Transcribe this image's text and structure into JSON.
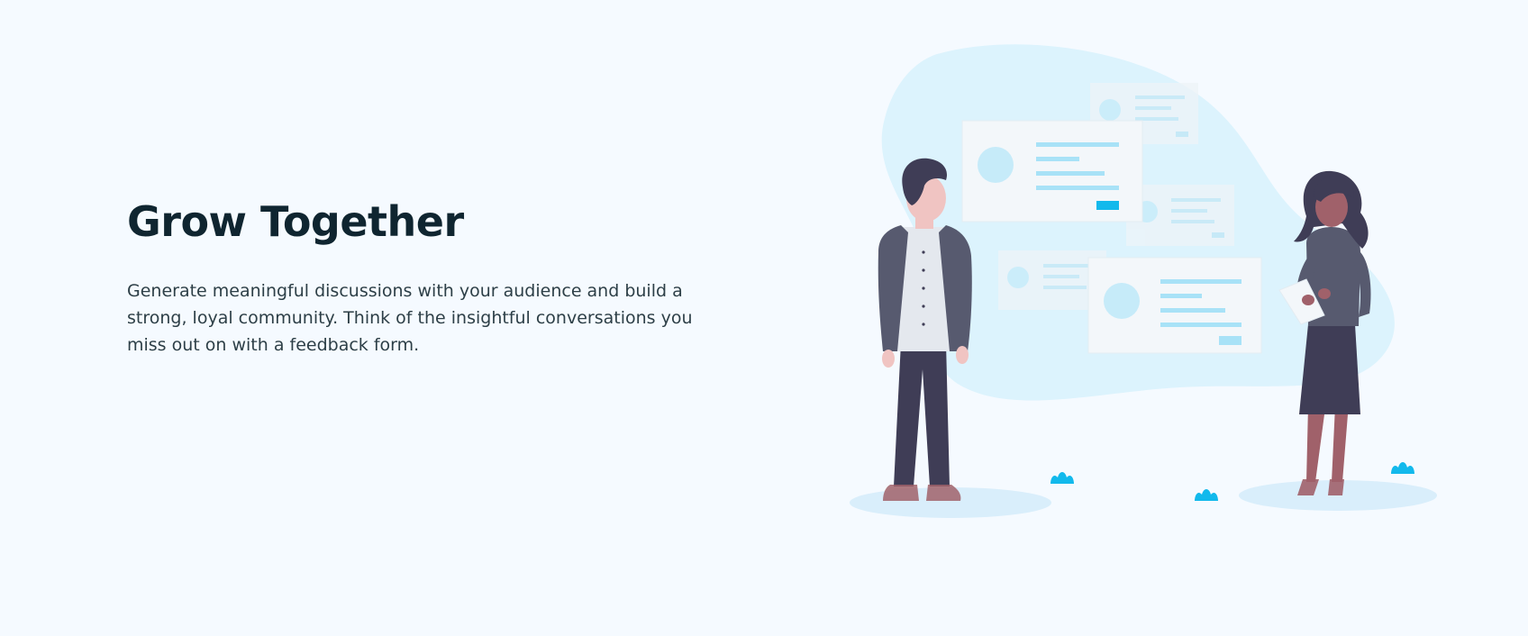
{
  "feature": {
    "title": "Grow Together",
    "description": "Generate meaningful discussions with your audience and build a strong, loyal community. Think of the insightful conversations you miss out on with a feedback form."
  },
  "illustration": {
    "icon": "people-discussion-illustration",
    "colors": {
      "blob": "#dcf3fd",
      "card": "#f3f7fa",
      "card_line": "#a8e2f7",
      "accent": "#12b9ec",
      "shadow": "#d9eefb"
    }
  },
  "colors": {
    "background": "#f5faff",
    "heading": "#0f2530",
    "body": "#2d3f47"
  }
}
